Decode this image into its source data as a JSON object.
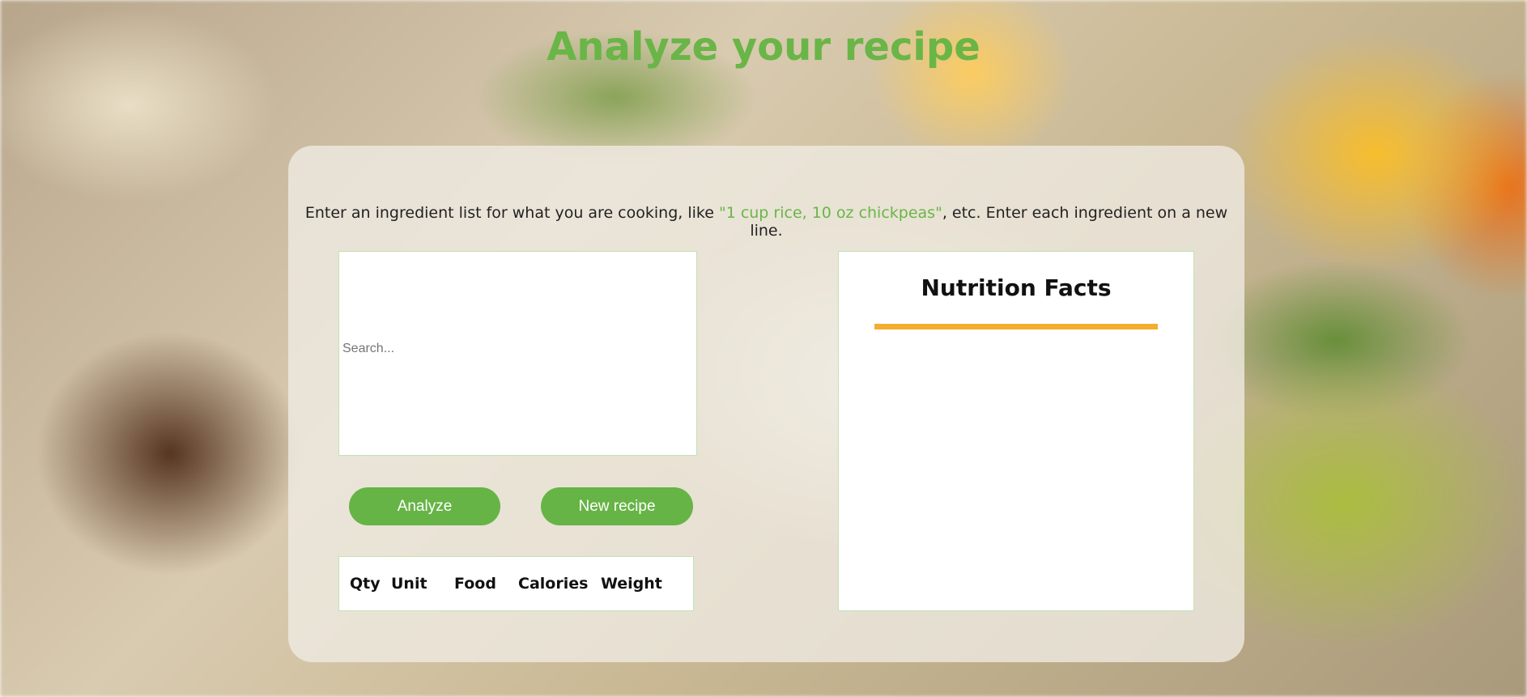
{
  "page": {
    "title": "Analyze your recipe"
  },
  "intro": {
    "before": "Enter an ingredient list for what you are cooking, like ",
    "example": "\"1 cup rice, 10 oz chickpeas\"",
    "after": ", etc. Enter each ingredient on a new line."
  },
  "search": {
    "placeholder": "Search...",
    "value": ""
  },
  "buttons": {
    "analyze_label": "Analyze",
    "new_recipe_label": "New recipe"
  },
  "ingredients_table": {
    "columns": [
      "Qty",
      "Unit",
      "Food",
      "Calories",
      "Weight"
    ],
    "rows": []
  },
  "nutrition": {
    "title": "Nutrition Facts"
  },
  "colors": {
    "accent_green": "#6ab547",
    "button_green": "#66b446",
    "rule_orange": "#f4ad2e",
    "border_green": "#bfe3b3"
  }
}
